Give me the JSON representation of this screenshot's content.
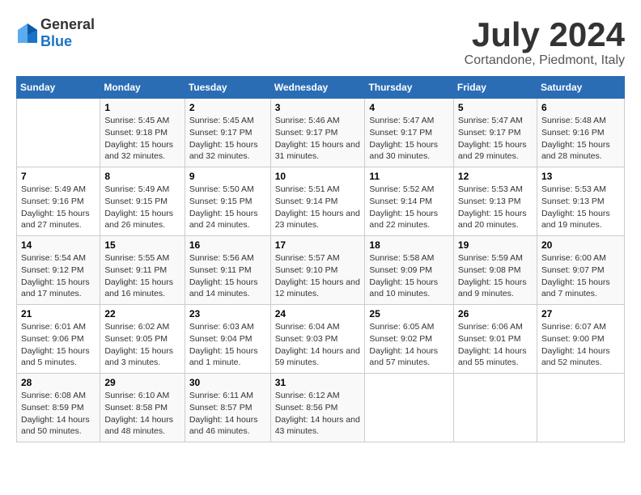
{
  "logo": {
    "general": "General",
    "blue": "Blue"
  },
  "title": {
    "month_year": "July 2024",
    "location": "Cortandone, Piedmont, Italy"
  },
  "days_of_week": [
    "Sunday",
    "Monday",
    "Tuesday",
    "Wednesday",
    "Thursday",
    "Friday",
    "Saturday"
  ],
  "weeks": [
    [
      {
        "day": "",
        "sunrise": "",
        "sunset": "",
        "daylight": ""
      },
      {
        "day": "1",
        "sunrise": "Sunrise: 5:45 AM",
        "sunset": "Sunset: 9:18 PM",
        "daylight": "Daylight: 15 hours and 32 minutes."
      },
      {
        "day": "2",
        "sunrise": "Sunrise: 5:45 AM",
        "sunset": "Sunset: 9:17 PM",
        "daylight": "Daylight: 15 hours and 32 minutes."
      },
      {
        "day": "3",
        "sunrise": "Sunrise: 5:46 AM",
        "sunset": "Sunset: 9:17 PM",
        "daylight": "Daylight: 15 hours and 31 minutes."
      },
      {
        "day": "4",
        "sunrise": "Sunrise: 5:47 AM",
        "sunset": "Sunset: 9:17 PM",
        "daylight": "Daylight: 15 hours and 30 minutes."
      },
      {
        "day": "5",
        "sunrise": "Sunrise: 5:47 AM",
        "sunset": "Sunset: 9:17 PM",
        "daylight": "Daylight: 15 hours and 29 minutes."
      },
      {
        "day": "6",
        "sunrise": "Sunrise: 5:48 AM",
        "sunset": "Sunset: 9:16 PM",
        "daylight": "Daylight: 15 hours and 28 minutes."
      }
    ],
    [
      {
        "day": "7",
        "sunrise": "Sunrise: 5:49 AM",
        "sunset": "Sunset: 9:16 PM",
        "daylight": "Daylight: 15 hours and 27 minutes."
      },
      {
        "day": "8",
        "sunrise": "Sunrise: 5:49 AM",
        "sunset": "Sunset: 9:15 PM",
        "daylight": "Daylight: 15 hours and 26 minutes."
      },
      {
        "day": "9",
        "sunrise": "Sunrise: 5:50 AM",
        "sunset": "Sunset: 9:15 PM",
        "daylight": "Daylight: 15 hours and 24 minutes."
      },
      {
        "day": "10",
        "sunrise": "Sunrise: 5:51 AM",
        "sunset": "Sunset: 9:14 PM",
        "daylight": "Daylight: 15 hours and 23 minutes."
      },
      {
        "day": "11",
        "sunrise": "Sunrise: 5:52 AM",
        "sunset": "Sunset: 9:14 PM",
        "daylight": "Daylight: 15 hours and 22 minutes."
      },
      {
        "day": "12",
        "sunrise": "Sunrise: 5:53 AM",
        "sunset": "Sunset: 9:13 PM",
        "daylight": "Daylight: 15 hours and 20 minutes."
      },
      {
        "day": "13",
        "sunrise": "Sunrise: 5:53 AM",
        "sunset": "Sunset: 9:13 PM",
        "daylight": "Daylight: 15 hours and 19 minutes."
      }
    ],
    [
      {
        "day": "14",
        "sunrise": "Sunrise: 5:54 AM",
        "sunset": "Sunset: 9:12 PM",
        "daylight": "Daylight: 15 hours and 17 minutes."
      },
      {
        "day": "15",
        "sunrise": "Sunrise: 5:55 AM",
        "sunset": "Sunset: 9:11 PM",
        "daylight": "Daylight: 15 hours and 16 minutes."
      },
      {
        "day": "16",
        "sunrise": "Sunrise: 5:56 AM",
        "sunset": "Sunset: 9:11 PM",
        "daylight": "Daylight: 15 hours and 14 minutes."
      },
      {
        "day": "17",
        "sunrise": "Sunrise: 5:57 AM",
        "sunset": "Sunset: 9:10 PM",
        "daylight": "Daylight: 15 hours and 12 minutes."
      },
      {
        "day": "18",
        "sunrise": "Sunrise: 5:58 AM",
        "sunset": "Sunset: 9:09 PM",
        "daylight": "Daylight: 15 hours and 10 minutes."
      },
      {
        "day": "19",
        "sunrise": "Sunrise: 5:59 AM",
        "sunset": "Sunset: 9:08 PM",
        "daylight": "Daylight: 15 hours and 9 minutes."
      },
      {
        "day": "20",
        "sunrise": "Sunrise: 6:00 AM",
        "sunset": "Sunset: 9:07 PM",
        "daylight": "Daylight: 15 hours and 7 minutes."
      }
    ],
    [
      {
        "day": "21",
        "sunrise": "Sunrise: 6:01 AM",
        "sunset": "Sunset: 9:06 PM",
        "daylight": "Daylight: 15 hours and 5 minutes."
      },
      {
        "day": "22",
        "sunrise": "Sunrise: 6:02 AM",
        "sunset": "Sunset: 9:05 PM",
        "daylight": "Daylight: 15 hours and 3 minutes."
      },
      {
        "day": "23",
        "sunrise": "Sunrise: 6:03 AM",
        "sunset": "Sunset: 9:04 PM",
        "daylight": "Daylight: 15 hours and 1 minute."
      },
      {
        "day": "24",
        "sunrise": "Sunrise: 6:04 AM",
        "sunset": "Sunset: 9:03 PM",
        "daylight": "Daylight: 14 hours and 59 minutes."
      },
      {
        "day": "25",
        "sunrise": "Sunrise: 6:05 AM",
        "sunset": "Sunset: 9:02 PM",
        "daylight": "Daylight: 14 hours and 57 minutes."
      },
      {
        "day": "26",
        "sunrise": "Sunrise: 6:06 AM",
        "sunset": "Sunset: 9:01 PM",
        "daylight": "Daylight: 14 hours and 55 minutes."
      },
      {
        "day": "27",
        "sunrise": "Sunrise: 6:07 AM",
        "sunset": "Sunset: 9:00 PM",
        "daylight": "Daylight: 14 hours and 52 minutes."
      }
    ],
    [
      {
        "day": "28",
        "sunrise": "Sunrise: 6:08 AM",
        "sunset": "Sunset: 8:59 PM",
        "daylight": "Daylight: 14 hours and 50 minutes."
      },
      {
        "day": "29",
        "sunrise": "Sunrise: 6:10 AM",
        "sunset": "Sunset: 8:58 PM",
        "daylight": "Daylight: 14 hours and 48 minutes."
      },
      {
        "day": "30",
        "sunrise": "Sunrise: 6:11 AM",
        "sunset": "Sunset: 8:57 PM",
        "daylight": "Daylight: 14 hours and 46 minutes."
      },
      {
        "day": "31",
        "sunrise": "Sunrise: 6:12 AM",
        "sunset": "Sunset: 8:56 PM",
        "daylight": "Daylight: 14 hours and 43 minutes."
      },
      {
        "day": "",
        "sunrise": "",
        "sunset": "",
        "daylight": ""
      },
      {
        "day": "",
        "sunrise": "",
        "sunset": "",
        "daylight": ""
      },
      {
        "day": "",
        "sunrise": "",
        "sunset": "",
        "daylight": ""
      }
    ]
  ]
}
